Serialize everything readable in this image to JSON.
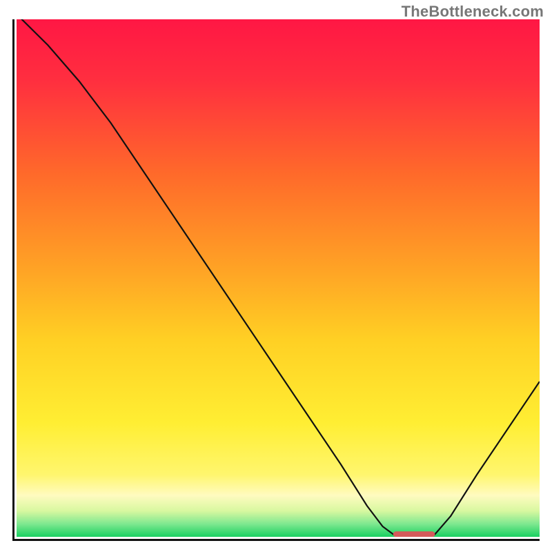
{
  "watermark": "TheBottleneck.com",
  "chart_data": {
    "type": "line",
    "title": "",
    "xlabel": "",
    "ylabel": "",
    "xlim": [
      0,
      100
    ],
    "ylim": [
      0,
      100
    ],
    "grid": false,
    "legend": false,
    "background_gradient_stops": [
      {
        "offset": 0.0,
        "color": "#ff1744"
      },
      {
        "offset": 0.12,
        "color": "#ff2f3f"
      },
      {
        "offset": 0.3,
        "color": "#ff6a2a"
      },
      {
        "offset": 0.48,
        "color": "#ffa225"
      },
      {
        "offset": 0.62,
        "color": "#ffd024"
      },
      {
        "offset": 0.78,
        "color": "#ffee33"
      },
      {
        "offset": 0.88,
        "color": "#fff66e"
      },
      {
        "offset": 0.92,
        "color": "#fffbc0"
      },
      {
        "offset": 0.95,
        "color": "#d8f8a0"
      },
      {
        "offset": 0.975,
        "color": "#7fe890"
      },
      {
        "offset": 1.0,
        "color": "#18d060"
      }
    ],
    "curve_points": [
      {
        "x": 0,
        "y": 101
      },
      {
        "x": 6,
        "y": 95
      },
      {
        "x": 12,
        "y": 88
      },
      {
        "x": 18,
        "y": 80
      },
      {
        "x": 22,
        "y": 74
      },
      {
        "x": 26,
        "y": 68
      },
      {
        "x": 32,
        "y": 59
      },
      {
        "x": 40,
        "y": 47
      },
      {
        "x": 48,
        "y": 35
      },
      {
        "x": 56,
        "y": 23
      },
      {
        "x": 62,
        "y": 14
      },
      {
        "x": 67,
        "y": 6
      },
      {
        "x": 70,
        "y": 2
      },
      {
        "x": 72,
        "y": 0.5
      },
      {
        "x": 75,
        "y": 0
      },
      {
        "x": 78,
        "y": 0
      },
      {
        "x": 80,
        "y": 0.5
      },
      {
        "x": 83,
        "y": 4
      },
      {
        "x": 88,
        "y": 12
      },
      {
        "x": 94,
        "y": 21
      },
      {
        "x": 100,
        "y": 30
      }
    ],
    "curve_color": "#111111",
    "curve_width": 2.2,
    "marker": {
      "x0": 72,
      "x1": 80,
      "y": 0.5,
      "color": "#d45a5a",
      "height_pct": 1.1,
      "radius_pct": 0.6
    }
  }
}
